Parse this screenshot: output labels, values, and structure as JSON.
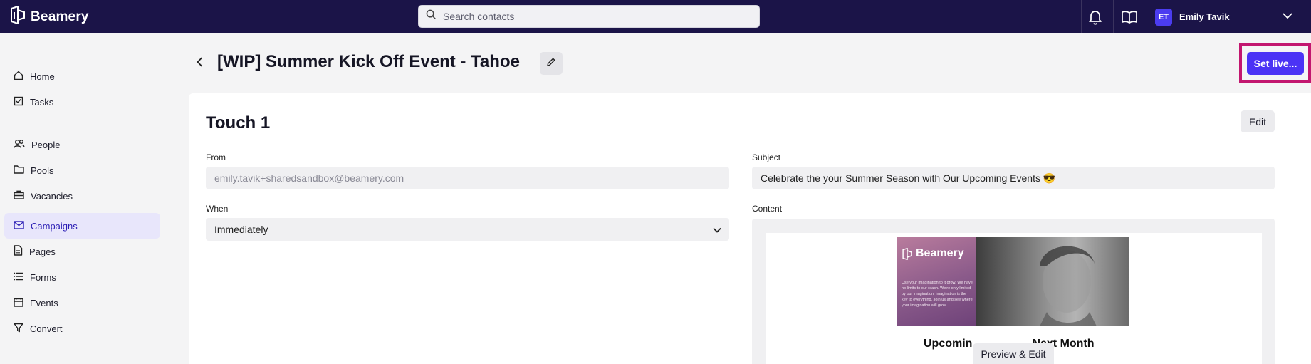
{
  "app": {
    "name": "Beamery"
  },
  "search": {
    "placeholder": "Search contacts"
  },
  "user": {
    "initials": "ET",
    "name": "Emily Tavik"
  },
  "sidebar": {
    "items": [
      {
        "label": "Home",
        "icon": "home-icon"
      },
      {
        "label": "Tasks",
        "icon": "tasks-icon"
      },
      {
        "label": "People",
        "icon": "people-icon"
      },
      {
        "label": "Pools",
        "icon": "folder-icon"
      },
      {
        "label": "Vacancies",
        "icon": "briefcase-icon"
      },
      {
        "label": "Campaigns",
        "icon": "mail-icon",
        "active": true
      },
      {
        "label": "Pages",
        "icon": "page-icon"
      },
      {
        "label": "Forms",
        "icon": "list-icon"
      },
      {
        "label": "Events",
        "icon": "calendar-icon"
      },
      {
        "label": "Convert",
        "icon": "filter-icon"
      }
    ]
  },
  "header": {
    "title": "[WIP] Summer Kick Off Event - Tahoe",
    "set_live_label": "Set live..."
  },
  "touch": {
    "title": "Touch 1",
    "edit_label": "Edit",
    "from_label": "From",
    "from_value": "emily.tavik+sharedsandbox@beamery.com",
    "when_label": "When",
    "when_value": "Immediately",
    "subject_label": "Subject",
    "subject_value": "Celebrate the your Summer Season with Our Upcoming Events 😎",
    "content_label": "Content",
    "preview": {
      "banner_logo": "Beamery",
      "banner_copy": "Use your imagination to it grow. We have no limits to our reach. We're only limited by our imagination. Imagination is the key to everything. Join us and see where your imagination will grow.",
      "heading_left": "Upcomin",
      "heading_right": "Next Month",
      "preview_edit_label": "Preview & Edit"
    }
  },
  "colors": {
    "topbar": "#1b1448",
    "accent": "#4b33f5",
    "highlight": "#c2166f",
    "active_nav_bg": "#e8e6fb"
  }
}
